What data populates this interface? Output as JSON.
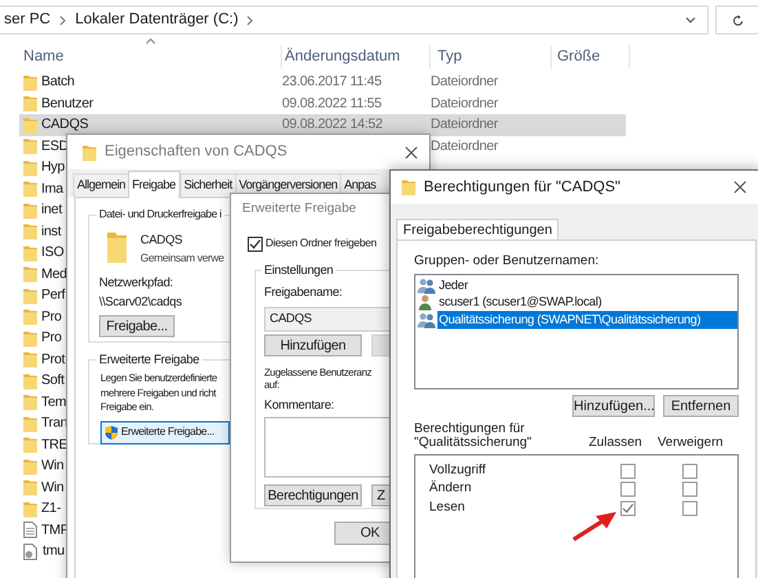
{
  "explorer": {
    "breadcrumb": [
      "ser PC",
      "Lokaler Datenträger (C:)"
    ],
    "columns": [
      "Name",
      "Änderungsdatum",
      "Typ",
      "Größe"
    ],
    "rows": [
      {
        "kind": "folder",
        "name": "Batch",
        "date": "23.06.2017 11:45",
        "type": "Dateiordner",
        "selected": false
      },
      {
        "kind": "folder",
        "name": "Benutzer",
        "date": "09.08.2022 11:55",
        "type": "Dateiordner",
        "selected": false
      },
      {
        "kind": "folder",
        "name": "CADQS",
        "date": "09.08.2022 14:52",
        "type": "Dateiordner",
        "selected": true
      },
      {
        "kind": "folder",
        "name": "ESD",
        "type": "Dateiordner",
        "selected": false
      },
      {
        "kind": "folder",
        "name": "Hyp",
        "selected": false
      },
      {
        "kind": "folder",
        "name": "Ima",
        "selected": false
      },
      {
        "kind": "folder",
        "name": "inet",
        "selected": false
      },
      {
        "kind": "folder",
        "name": "inst",
        "selected": false
      },
      {
        "kind": "folder",
        "name": "ISO",
        "selected": false
      },
      {
        "kind": "folder",
        "name": "Med",
        "selected": false
      },
      {
        "kind": "folder",
        "name": "Perf",
        "selected": false
      },
      {
        "kind": "folder",
        "name": "Pro",
        "selected": false
      },
      {
        "kind": "folder",
        "name": "Pro",
        "selected": false
      },
      {
        "kind": "folder",
        "name": "Prot",
        "selected": false
      },
      {
        "kind": "folder",
        "name": "Soft",
        "selected": false
      },
      {
        "kind": "folder",
        "name": "Tem",
        "selected": false
      },
      {
        "kind": "folder",
        "name": "Tran",
        "selected": false
      },
      {
        "kind": "folder",
        "name": "TRE",
        "selected": false
      },
      {
        "kind": "folder",
        "name": "Win",
        "selected": false
      },
      {
        "kind": "folder",
        "name": "Win",
        "selected": false
      },
      {
        "kind": "folder",
        "name": "Z1-",
        "selected": false
      },
      {
        "kind": "file",
        "name": "TMP",
        "selected": false
      },
      {
        "kind": "settings-file",
        "name": "tmu",
        "selected": false
      }
    ]
  },
  "properties_dialog": {
    "title": "Eigenschaften von CADQS",
    "tabs": [
      {
        "label": "Allgemein",
        "selected": false
      },
      {
        "label": "Freigabe",
        "selected": true
      },
      {
        "label": "Sicherheit",
        "selected": false
      },
      {
        "label": "Vorgängerversionen",
        "selected": false
      },
      {
        "label": "Anpas",
        "selected": false
      }
    ],
    "file_sharing": {
      "heading": "Datei- und Druckerfreigabe i",
      "folder_name": "CADQS",
      "folder_status": "Gemeinsam verwe",
      "network_path_label": "Netzwerkpfad:",
      "network_path": "\\\\Scarv02\\cadqs",
      "share_button": "Freigabe..."
    },
    "advanced_sharing": {
      "heading": "Erweiterte Freigabe",
      "lines": [
        "Legen Sie benutzerdefinierte",
        "mehrere Freigaben und richt",
        "Freigabe ein."
      ],
      "button": "Erweiterte Freigabe..."
    }
  },
  "advanced_dialog": {
    "title": "Erweiterte Freigabe",
    "share_checkbox": {
      "label": "Diesen Ordner freigeben",
      "checked": true
    },
    "settings_heading": "Einstellungen",
    "share_name_label": "Freigabename:",
    "share_name": "CADQS",
    "add_button": "Hinzufügen",
    "user_limit_lines": [
      "Zugelassene Benutzeranz",
      "auf:"
    ],
    "comments_label": "Kommentare:",
    "permissions_button": "Berechtigungen",
    "caching_button": "Z",
    "ok_button": "OK"
  },
  "permissions_dialog": {
    "title": "Berechtigungen für \"CADQS\"",
    "tab": {
      "label": "Freigabeberechtigungen",
      "selected": true
    },
    "users_label": "Gruppen- oder Benutzernamen:",
    "users": [
      {
        "kind": "group",
        "name": "Jeder",
        "selected": false
      },
      {
        "kind": "user",
        "name": "scuser1 (scuser1@SWAP.local)",
        "selected": false
      },
      {
        "kind": "group",
        "name": "Qualitätssicherung (SWAPNET\\Qualitätssicherung)",
        "selected": true
      }
    ],
    "add_button": "Hinzufügen...",
    "remove_button": "Entfernen",
    "permissions_label_lines": [
      "Berechtigungen für",
      "\"Qualitätssicherung\""
    ],
    "allow_header": "Zulassen",
    "deny_header": "Verweigern",
    "permissions": [
      {
        "name": "Vollzugriff",
        "allow": false,
        "deny": false
      },
      {
        "name": "Ändern",
        "allow": false,
        "deny": false
      },
      {
        "name": "Lesen",
        "allow": true,
        "deny": false
      }
    ]
  }
}
